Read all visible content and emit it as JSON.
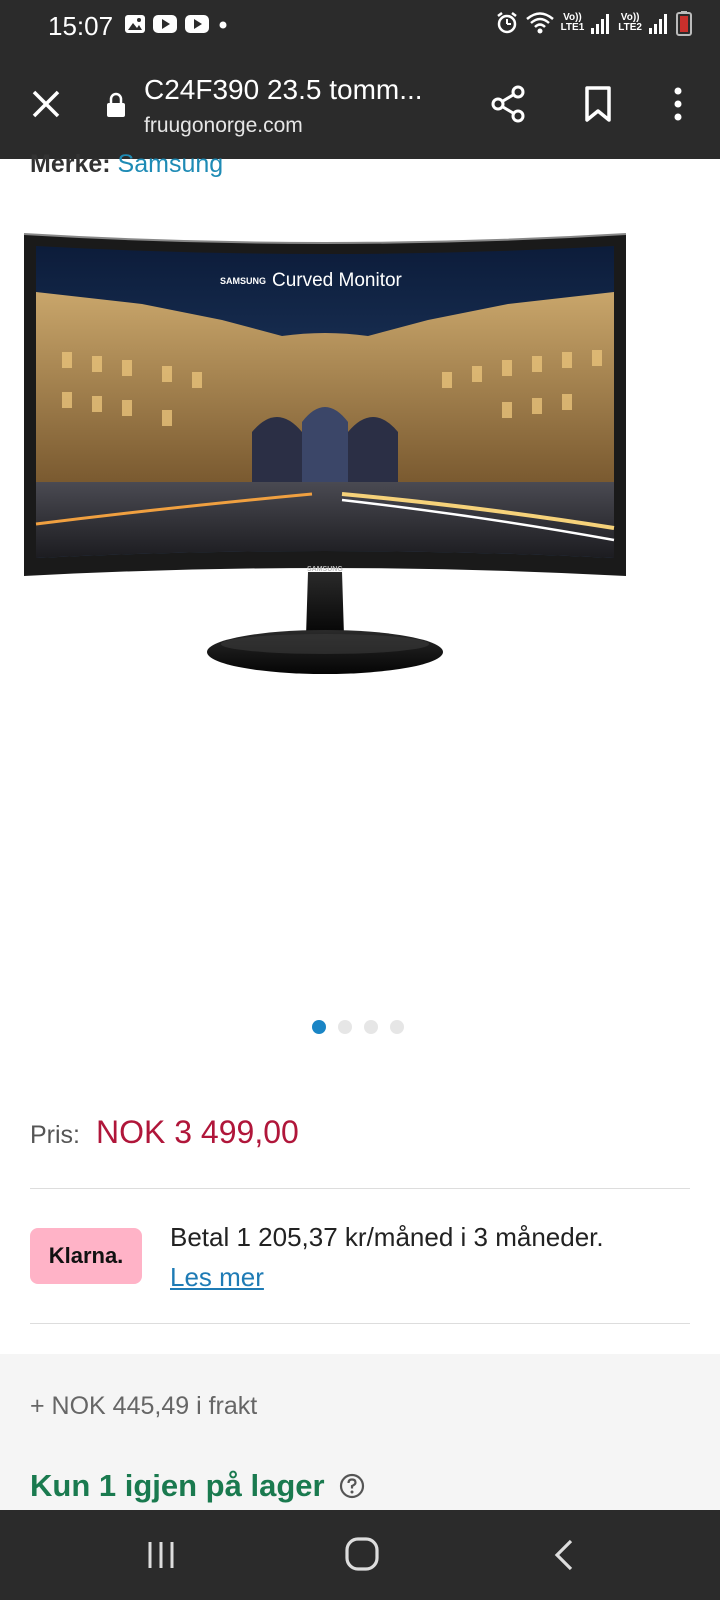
{
  "status_bar": {
    "time": "15:07",
    "sim1": {
      "top": "Vo))",
      "bottom": "LTE1"
    },
    "sim2": {
      "top": "Vo))",
      "bottom": "LTE2"
    }
  },
  "browser": {
    "page_title": "C24F390 23.5 tomm...",
    "url": "fruugonorge.com"
  },
  "product": {
    "brand_label": "Merke:",
    "brand_name": "Samsung",
    "image": {
      "screen_brand": "SAMSUNG",
      "screen_caption": "Curved Monitor",
      "bezel_logo": "SAMSUNG"
    },
    "carousel": {
      "count": 4,
      "active_index": 0
    },
    "price_label": "Pris:",
    "price_value": "NOK 3 499,00",
    "klarna": {
      "badge": "Klarna.",
      "text": "Betal 1 205,37 kr/måned i 3 måneder.",
      "link": "Les mer"
    },
    "shipping": "+ NOK 445,49 i frakt",
    "stock": "Kun 1 igjen på lager"
  },
  "colors": {
    "bars": "#2b2b2b",
    "price": "#b0163a",
    "link": "#1e8bb5",
    "stock": "#1a7a4f",
    "klarna_pink": "#ffb3c7",
    "dot_active": "#1a85c5"
  }
}
